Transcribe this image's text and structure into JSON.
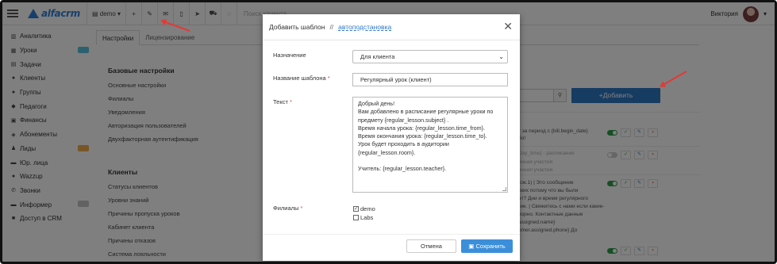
{
  "app": {
    "logo": "alfacrm",
    "branch": "demo",
    "search_placeholder": "Поиск клиента",
    "user_name": "Виктория"
  },
  "sidebar": {
    "items": [
      {
        "label": "Аналитика",
        "icon": "analytics-icon"
      },
      {
        "label": "Уроки",
        "icon": "calendar-icon",
        "badge": "blue"
      },
      {
        "label": "Задачи",
        "icon": "tasks-icon"
      },
      {
        "label": "Клиенты",
        "icon": "user-icon"
      },
      {
        "label": "Группы",
        "icon": "group-icon"
      },
      {
        "label": "Педагоги",
        "icon": "teacher-icon"
      },
      {
        "label": "Финансы",
        "icon": "money-icon"
      },
      {
        "label": "Абонементы",
        "icon": "subscription-icon"
      },
      {
        "label": "Лиды",
        "icon": "leads-icon",
        "badge": "orange"
      },
      {
        "label": "Юр. лица",
        "icon": "company-icon"
      },
      {
        "label": "Wazzup",
        "icon": "chat-icon"
      },
      {
        "label": "Звонки",
        "icon": "phone-icon"
      },
      {
        "label": "Информер",
        "icon": "informer-icon",
        "badge": "grey"
      },
      {
        "label": "Доступ в CRM",
        "icon": "lock-icon"
      }
    ]
  },
  "tabs": [
    "Настройки",
    "Лицензирование"
  ],
  "settings": {
    "basic_title": "Базовые настройки",
    "basic_items": [
      "Основные настройки",
      "Филиалы",
      "Уведомления",
      "Авторизация пользователей",
      "Двухфакторная аутентификация"
    ],
    "clients_title": "Клиенты",
    "clients_items": [
      "Статусы клиентов",
      "Уровни знаний",
      "Причины пропуска уроков",
      "Кабинет клиента",
      "Причины отказов",
      "Система лояльности"
    ]
  },
  "background": {
    "add_button": "+Добавить",
    "row1": [
      "т за период с {bill.begin_date}",
      "бо!"
    ],
    "row2": [
      "Day_time} - расписание",
      "чиная участия",
      "очнил участия"
    ],
    "row3": [
      "сок.1) | Это сообщение",
      "ских потому что вы были",
      "нт? Дни и время регулярного",
      "гие. | Свяжитесь с нами если какие-",
      "порно. Контактные данные",
      "assigned.name}",
      "omer.assigned.phone} До"
    ]
  },
  "modal": {
    "title": "Добавить шаблон",
    "separator": "//",
    "link": "автоподстановка",
    "purpose_label": "Назначение",
    "purpose_value": "Для клиента",
    "name_label": "Название шаблона",
    "name_value": "Регулярный урок (клиент)",
    "text_label": "Текст",
    "text_lines": [
      "Добрый день!",
      "Вам добавлено в расписание регулярные уроки по",
      "предмету {regular_lesson.subject} .",
      "Время начала урока: {regular_lesson.time_from}.",
      "Время окончания урока: {regular_lesson.time_to}.",
      "Урок будет проходить в аудитории",
      "{regular_lesson.room}.",
      "",
      "Учитель: {regular_lesson.teacher}."
    ],
    "branches_label": "Филиалы",
    "branches": [
      {
        "name": "demo",
        "checked": true
      },
      {
        "name": "Labs",
        "checked": false
      }
    ],
    "required_mark": "*",
    "cancel": "Отмена",
    "save": "Сохранить"
  },
  "colors": {
    "accent": "#2f78c4",
    "save": "#3b8fd9",
    "annotation_arrow": "#e53935"
  }
}
